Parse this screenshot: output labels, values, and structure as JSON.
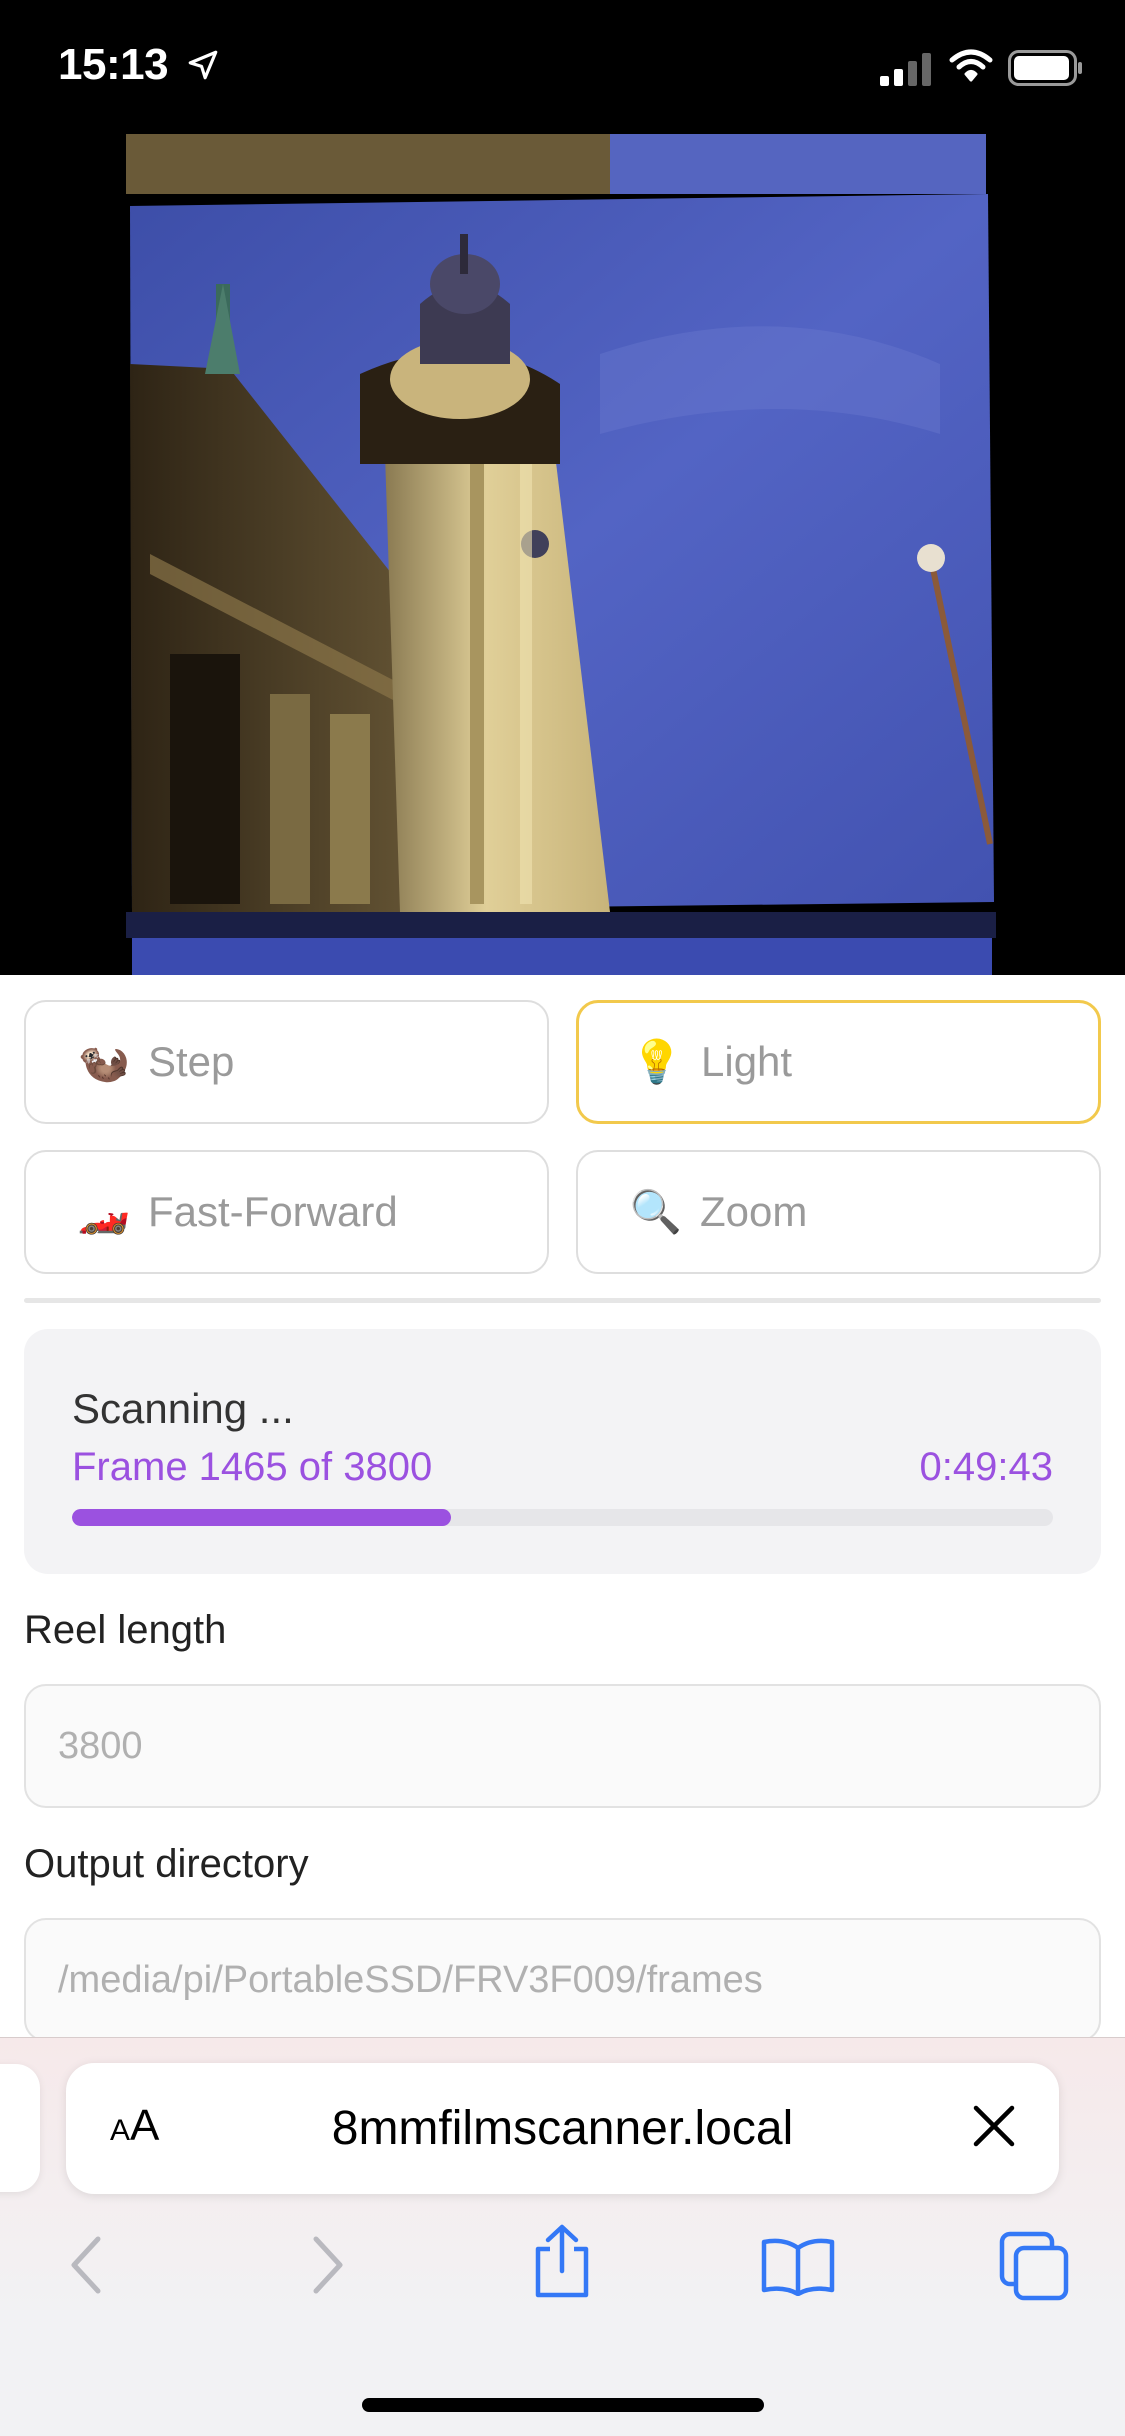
{
  "status_bar": {
    "time": "15:13",
    "icons": [
      "location-arrow-icon",
      "cellular-signal-icon",
      "wifi-icon",
      "battery-icon"
    ]
  },
  "preview": {
    "description_icon": "film-frame-image"
  },
  "controls": {
    "step": {
      "emoji": "🦦",
      "label": "Step"
    },
    "light": {
      "emoji": "💡",
      "label": "Light",
      "active": true
    },
    "fast_forward": {
      "emoji": "🏎️",
      "label": "Fast-Forward"
    },
    "zoom": {
      "emoji": "🔍",
      "label": "Zoom"
    }
  },
  "scan": {
    "title": "Scanning ...",
    "frame_text": "Frame 1465 of 3800",
    "elapsed": "0:49:43",
    "progress": 0.386
  },
  "reel_length": {
    "label": "Reel length",
    "placeholder": "3800"
  },
  "output_directory": {
    "label": "Output directory",
    "placeholder": "/media/pi/PortableSSD/FRV3F009/frames"
  },
  "browser": {
    "text_size_label": "AA",
    "url": "8mmfilmscanner.local",
    "accent": "#3478f6"
  },
  "colors": {
    "accent_purple": "#9b51e0",
    "active_border": "#f2c94c"
  }
}
